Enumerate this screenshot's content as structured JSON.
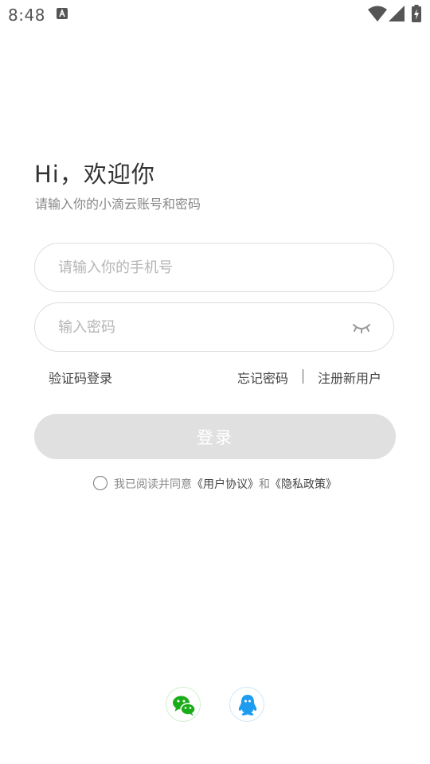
{
  "status_bar": {
    "time": "8:48",
    "notification_icon": "text-a-notification-icon",
    "wifi_icon": "wifi-icon",
    "signal_icon": "cell-signal-icon",
    "battery_icon": "battery-charging-icon"
  },
  "greeting": {
    "title": "Hi，欢迎你",
    "subtitle": "请输入你的小滴云账号和密码"
  },
  "form": {
    "phone_placeholder": "请输入你的手机号",
    "phone_value": "",
    "password_placeholder": "输入密码",
    "password_value": "",
    "password_toggle_icon": "eye-closed-icon"
  },
  "links": {
    "sms_login": "验证码登录",
    "forgot_password": "忘记密码",
    "divider": "|",
    "register": "注册新用户"
  },
  "login_button": {
    "label": "登录"
  },
  "agreement": {
    "prefix": "我已阅读并同意",
    "user_agreement": "《用户协议》",
    "conjunction": "和",
    "privacy_policy": "《隐私政策》",
    "checked": false
  },
  "third_party": {
    "wechat_icon": "wechat-icon",
    "qq_icon": "qq-icon"
  },
  "colors": {
    "text_primary": "#333333",
    "text_secondary": "#888888",
    "placeholder": "#b5b5b5",
    "input_border": "#dddddd",
    "button_disabled_bg": "#e0e0e0",
    "wechat_green": "#1aad19",
    "qq_blue": "#1e9cf0"
  }
}
